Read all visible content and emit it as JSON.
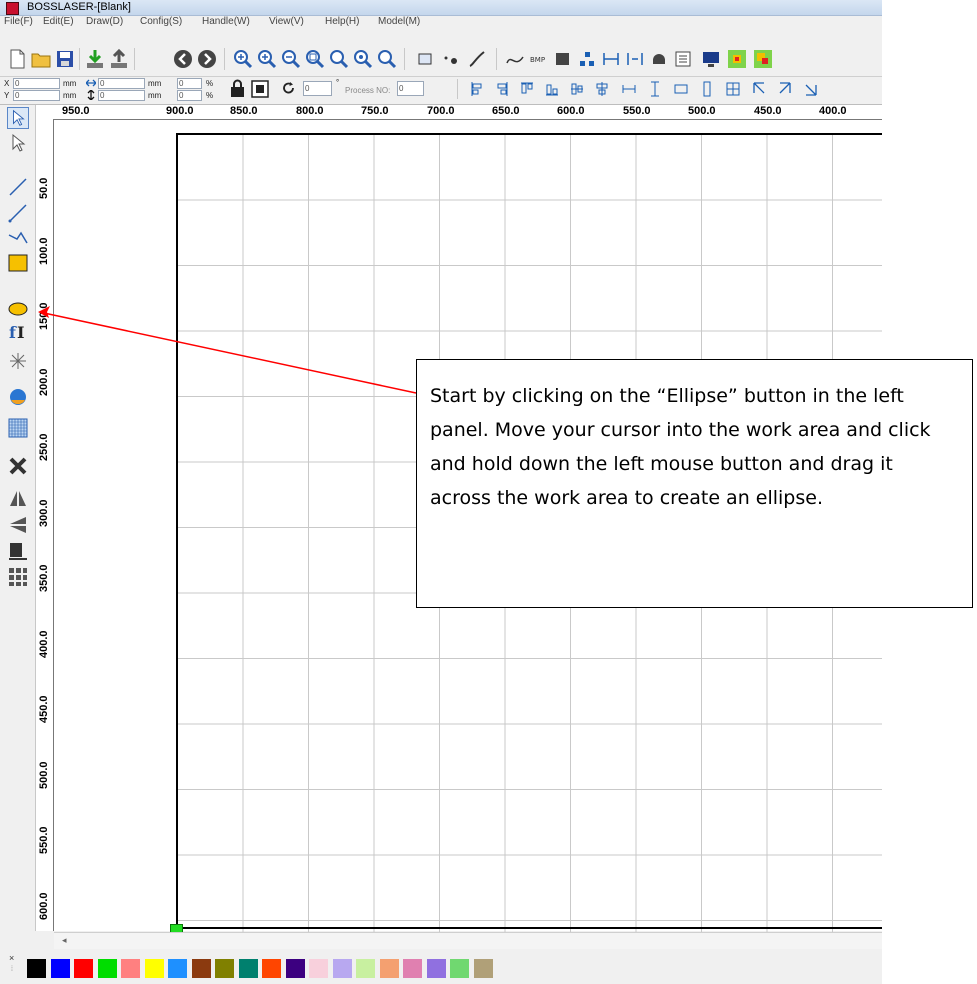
{
  "window": {
    "title": "BOSSLASER-[Blank]"
  },
  "menu": [
    "File(F)",
    "Edit(E)",
    "Draw(D)",
    "Config(S)",
    "Handle(W)",
    "View(V)",
    "Help(H)",
    "Model(M)"
  ],
  "toolbar2": {
    "x_label": "X",
    "y_label": "Y",
    "x_value": "0",
    "y_value": "0",
    "unit": "mm",
    "width_value": "0",
    "height_value": "0",
    "scale_x": "0",
    "scale_y": "0",
    "percent": "%",
    "rotate_value": "0",
    "degree": "°",
    "process_placeholder": "Process NO:",
    "process_value": "0"
  },
  "ruler_top": [
    "950.0",
    "900.0",
    "850.0",
    "800.0",
    "750.0",
    "700.0",
    "650.0",
    "600.0",
    "550.0",
    "500.0",
    "450.0",
    "400.0"
  ],
  "ruler_left": [
    "50.0",
    "100.0",
    "150.0",
    "200.0",
    "250.0",
    "300.0",
    "350.0",
    "400.0",
    "450.0",
    "500.0",
    "550.0",
    "600.0"
  ],
  "palette": [
    "#000000",
    "#0000ff",
    "#ff0000",
    "#00dd00",
    "#ff8080",
    "#ffff00",
    "#1e90ff",
    "#8b3a0f",
    "#808000",
    "#00806e",
    "#ff4500",
    "#3c0080",
    "#f8d0dc",
    "#b8a8f0",
    "#c8f0a0",
    "#f4a070",
    "#e080b0",
    "#9070e0",
    "#70d870",
    "#b0a078"
  ],
  "callout": {
    "text": "Start by clicking on the “Ellipse” button in the left panel.   Move your cursor into the work area and click and hold down the left mouse button and drag it across the work area to create an ellipse."
  }
}
